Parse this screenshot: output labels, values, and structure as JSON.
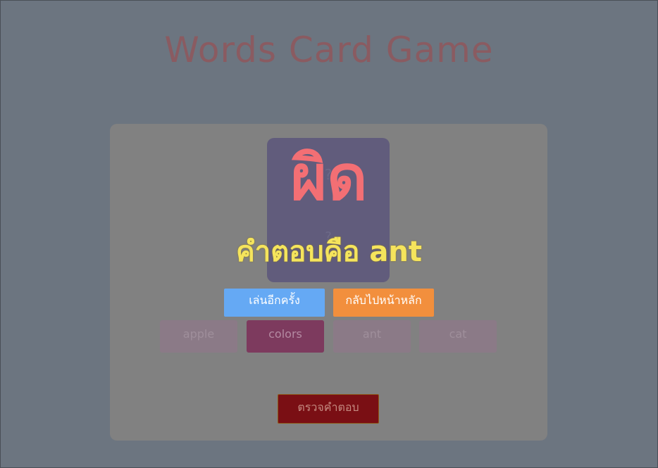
{
  "title": "Words Card Game",
  "card": {
    "top_text": "?",
    "bottom_text": "?"
  },
  "choices": [
    {
      "label": "apple",
      "selected": false
    },
    {
      "label": "colors",
      "selected": true
    },
    {
      "label": "ant",
      "selected": false
    },
    {
      "label": "cat",
      "selected": false
    }
  ],
  "check_button": "ตรวจคำตอบ",
  "result": {
    "status": "ผิด",
    "answer_text": "คำตอบคือ ant",
    "play_again": "เล่นอีกครั้ง",
    "back_home": "กลับไปหน้าหลัก"
  },
  "colors": {
    "wrong": "#f36f74",
    "answer": "#f5e45c",
    "play_again_bg": "#65a9f4",
    "back_home_bg": "#f28f3d"
  }
}
